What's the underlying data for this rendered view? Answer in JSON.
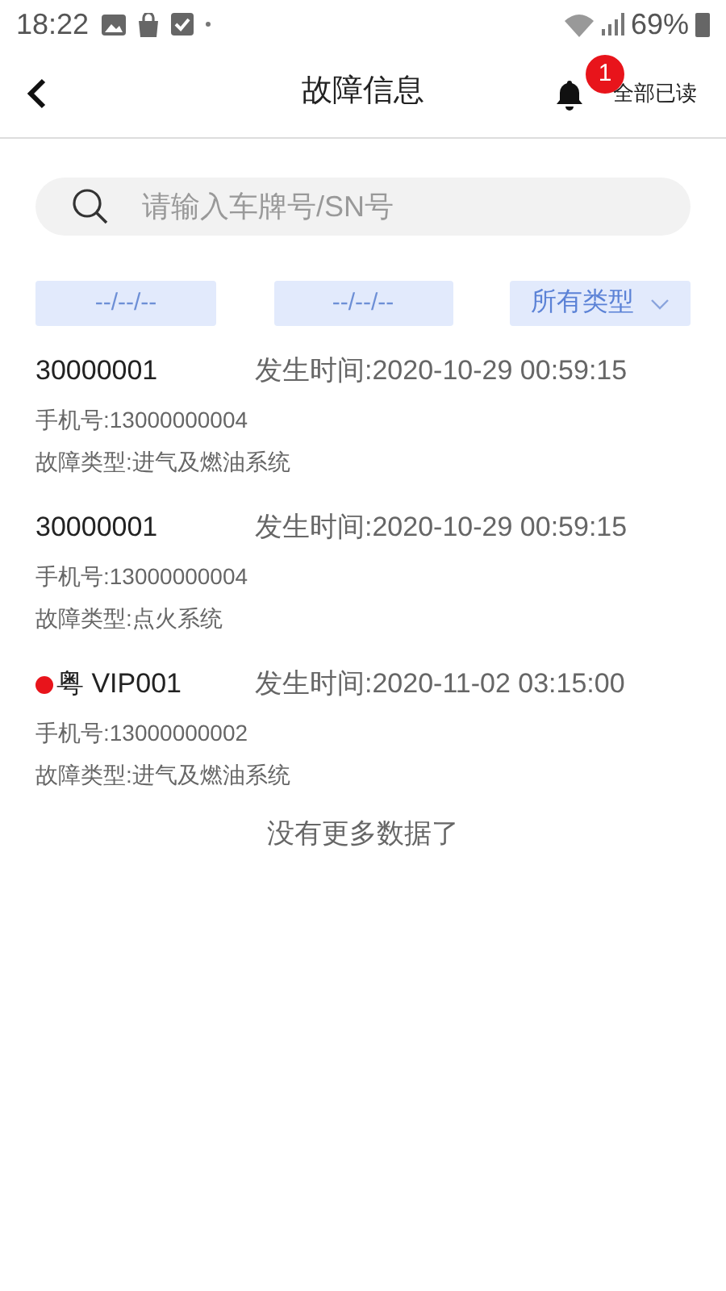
{
  "status_bar": {
    "time": "18:22",
    "battery": "69%"
  },
  "header": {
    "title": "故障信息",
    "badge": "1",
    "mark_all_read": "全部已读"
  },
  "search": {
    "placeholder": "请输入车牌号/SN号"
  },
  "filters": {
    "start_date": "--/--/--",
    "end_date": "--/--/--",
    "type": "所有类型"
  },
  "records": [
    {
      "plate": "30000001",
      "unread": false,
      "time": "发生时间:2020-10-29 00:59:15",
      "phone": "手机号:13000000004",
      "fault_type": "故障类型:进气及燃油系统"
    },
    {
      "plate": "30000001",
      "unread": false,
      "time": "发生时间:2020-10-29 00:59:15",
      "phone": "手机号:13000000004",
      "fault_type": "故障类型:点火系统"
    },
    {
      "plate": "粤 VIP001",
      "unread": true,
      "time": "发生时间:2020-11-02 03:15:00",
      "phone": "手机号:13000000002",
      "fault_type": "故障类型:进气及燃油系统"
    }
  ],
  "footer": "没有更多数据了"
}
